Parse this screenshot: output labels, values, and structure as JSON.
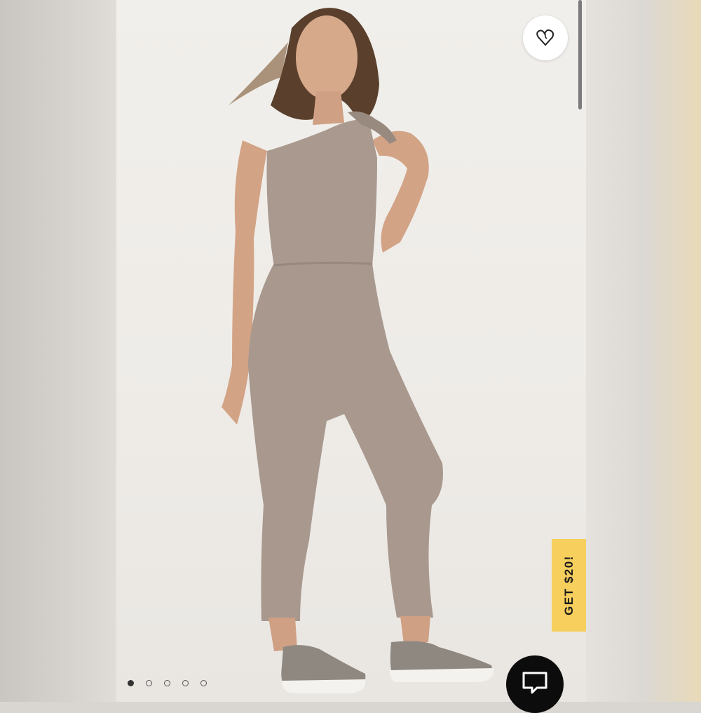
{
  "product_image": {
    "alt": "",
    "favorite_icon": "heart-icon"
  },
  "promo": {
    "label": "GET $20!",
    "color": "#f6cf5d"
  },
  "chat": {
    "icon": "chat-bubble-icon"
  },
  "carousel": {
    "total": 5,
    "active_index": 0
  }
}
